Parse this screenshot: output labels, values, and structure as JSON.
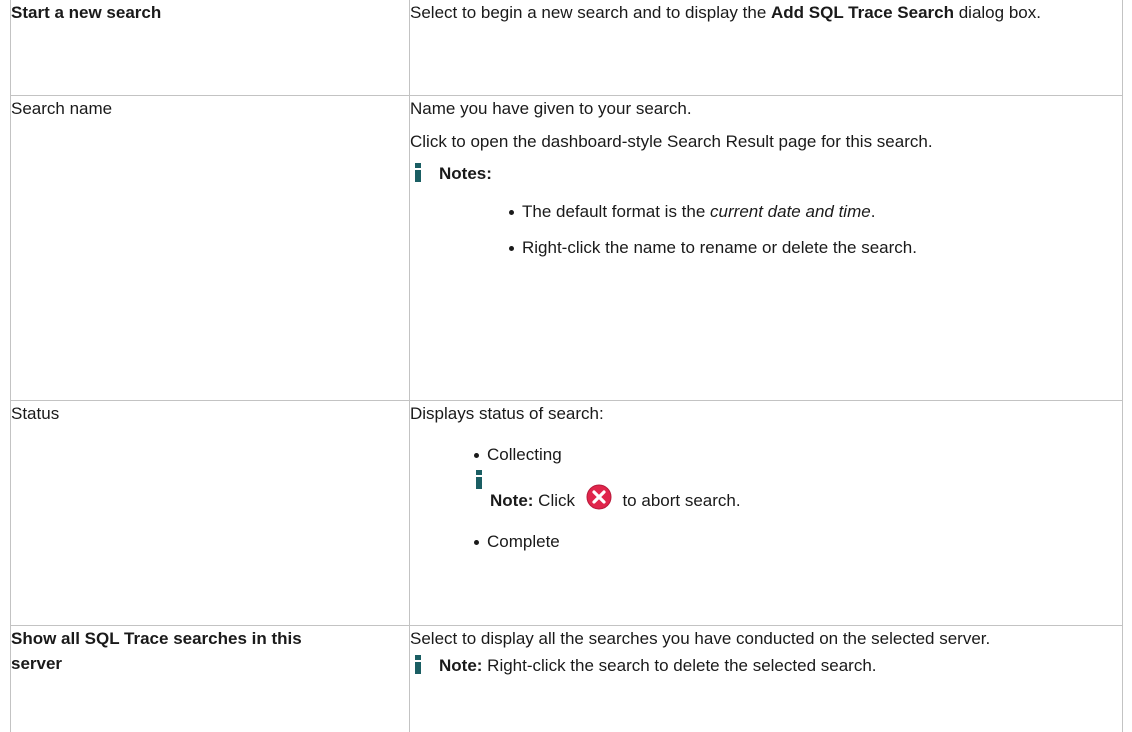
{
  "rows": [
    {
      "left": "Start a new search",
      "right": {
        "before": "Select to begin a new search and to display the ",
        "strong": "Add SQL Trace Search",
        "after": " dialog box."
      }
    },
    {
      "left": "Search name",
      "right": {
        "line1": "Name you have given to your search.",
        "line2": "Click to open the dashboard-style Search Result page for this search.",
        "notes_label": "Notes:",
        "bullets": [
          {
            "before": "The default format is the ",
            "em": "current date and time",
            "after": "."
          },
          {
            "text": "Right-click the name to rename or delete the search."
          }
        ]
      }
    },
    {
      "left": "Status",
      "right": {
        "intro": "Displays status of search:",
        "bullet1": "Collecting",
        "note_label": "Note:",
        "note_text_before": " Click ",
        "note_text_after": " to abort search.",
        "bullet2": "Complete"
      }
    },
    {
      "left": "Show all SQL Trace searches in this server",
      "right": {
        "line1": "Select to display all the searches you have conducted on the selected server.",
        "note_label": "Note:",
        "note_text": " Right-click the search to delete the selected search."
      }
    }
  ],
  "icons": {
    "info": "info-icon",
    "abort": "abort-icon"
  },
  "colors": {
    "info_icon": "#1a5e63",
    "abort_icon": "#e0254b",
    "border": "#c3c3c3",
    "text": "#1a1a1a"
  }
}
